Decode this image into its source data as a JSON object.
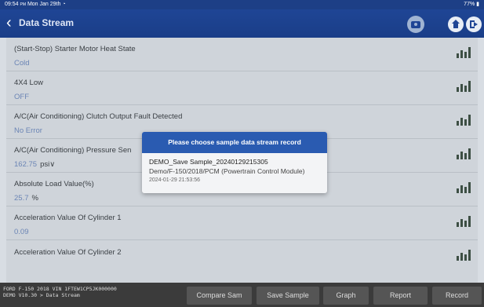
{
  "status": {
    "time": "09:54",
    "ampm": "PM",
    "date": "Mon Jan 29th",
    "battery": "77%"
  },
  "header": {
    "title": "Data Stream"
  },
  "rows": [
    {
      "name": "(Start-Stop) Starter Motor Heat State",
      "value": "Cold",
      "unit": ""
    },
    {
      "name": "4X4 Low",
      "value": "OFF",
      "unit": ""
    },
    {
      "name": "A/C(Air Conditioning) Clutch Output Fault Detected",
      "value": "No Error",
      "unit": ""
    },
    {
      "name": "A/C(Air Conditioning) Pressure Sen",
      "value": "162.75",
      "unit": "psi∨"
    },
    {
      "name": "Absolute Load Value(%)",
      "value": "25.7",
      "unit": "%"
    },
    {
      "name": "Acceleration Value Of Cylinder 1",
      "value": "0.09",
      "unit": ""
    },
    {
      "name": "Acceleration Value Of Cylinder 2",
      "value": "",
      "unit": ""
    }
  ],
  "popup": {
    "title": "Please choose sample data stream record",
    "record_name": "DEMO_Save Sample_20240129215305",
    "record_path": "Demo/F-150/2018/PCM (Powertrain Control Module)",
    "record_time": "2024-01-29 21:53:56"
  },
  "footer": {
    "vehicle": "FORD  F-150  2018  VIN  1FTEW1CP5JK000000",
    "path": "DEMO V10.30 > Data Stream",
    "buttons": [
      "Compare Sam",
      "Save Sample",
      "Graph",
      "Report",
      "Record"
    ]
  },
  "colors": {
    "header": "#1f4595",
    "value": "#6b85b5",
    "footer": "#3b3b3b"
  }
}
